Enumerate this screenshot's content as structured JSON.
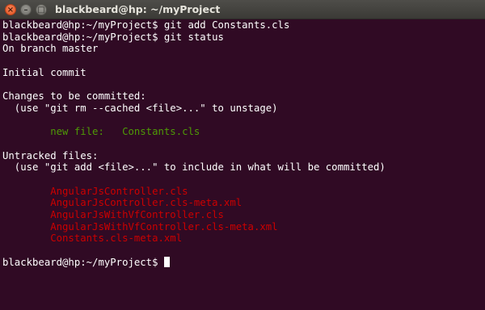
{
  "window": {
    "title": "blackbeard@hp: ~/myProject",
    "controls": {
      "close_glyph": "×",
      "minimize_glyph": "–",
      "maximize_glyph": "□"
    }
  },
  "terminal": {
    "background": "#300a24",
    "colors": {
      "staged": "#4e9a06",
      "untracked": "#cc0000",
      "text": "#ffffff"
    },
    "lines": [
      "blackbeard@hp:~/myProject$ git add Constants.cls",
      "blackbeard@hp:~/myProject$ git status",
      "On branch master",
      "",
      "Initial commit",
      "",
      "Changes to be committed:",
      "  (use \"git rm --cached <file>...\" to unstage)",
      "",
      "        new file:   Constants.cls",
      "",
      "Untracked files:",
      "  (use \"git add <file>...\" to include in what will be committed)",
      "",
      "        AngularJsController.cls",
      "        AngularJsController.cls-meta.xml",
      "        AngularJsWithVfController.cls",
      "        AngularJsWithVfController.cls-meta.xml",
      "        Constants.cls-meta.xml",
      "",
      "blackbeard@hp:~/myProject$ "
    ]
  }
}
